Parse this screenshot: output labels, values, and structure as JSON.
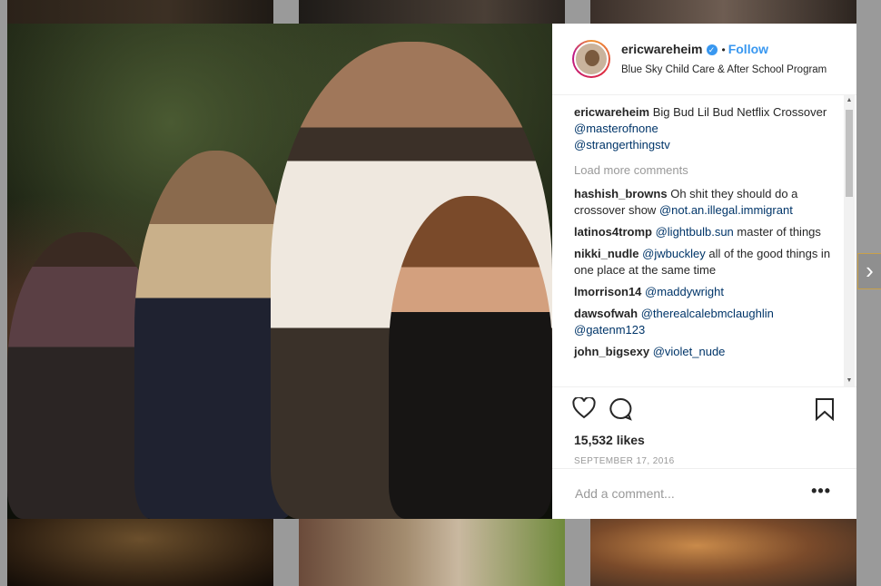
{
  "post": {
    "username": "ericwareheim",
    "verified_symbol": "✓",
    "dot": "•",
    "follow_label": "Follow",
    "location": "Blue Sky Child Care & After School Program"
  },
  "caption": {
    "username": "ericwareheim",
    "text": "Big Bud Lil Bud Netflix Crossover",
    "mentions": [
      "@masterofnone",
      "@strangerthingstv"
    ]
  },
  "load_more_label": "Load more comments",
  "comments": [
    {
      "user": "hashish_browns",
      "text": "Oh shit they should do a crossover show",
      "mention": "@not.an.illegal.immigrant",
      "after": ""
    },
    {
      "user": "latinos4tromp",
      "text": "",
      "mention": "@lightbulb.sun",
      "after": "master of things"
    },
    {
      "user": "nikki_nudle",
      "text": "",
      "mention": "@jwbuckley",
      "after": "all of the good things in one place at the same time"
    },
    {
      "user": "lmorrison14",
      "text": "",
      "mention": "@maddywright",
      "after": ""
    },
    {
      "user": "dawsofwah",
      "text": "",
      "mention": "@therealcalebmclaughlin @gatenm123",
      "after": ""
    },
    {
      "user": "john_bigsexy",
      "text": "",
      "mention": "@violet_nude",
      "after": ""
    }
  ],
  "likes": "15,532 likes",
  "date": "SEPTEMBER 17, 2016",
  "add_comment_placeholder": "Add a comment...",
  "more_label": "•••",
  "next_arrow": "›",
  "icons": [
    "heart-icon",
    "comment-icon",
    "bookmark-icon",
    "chevron-right-icon"
  ]
}
